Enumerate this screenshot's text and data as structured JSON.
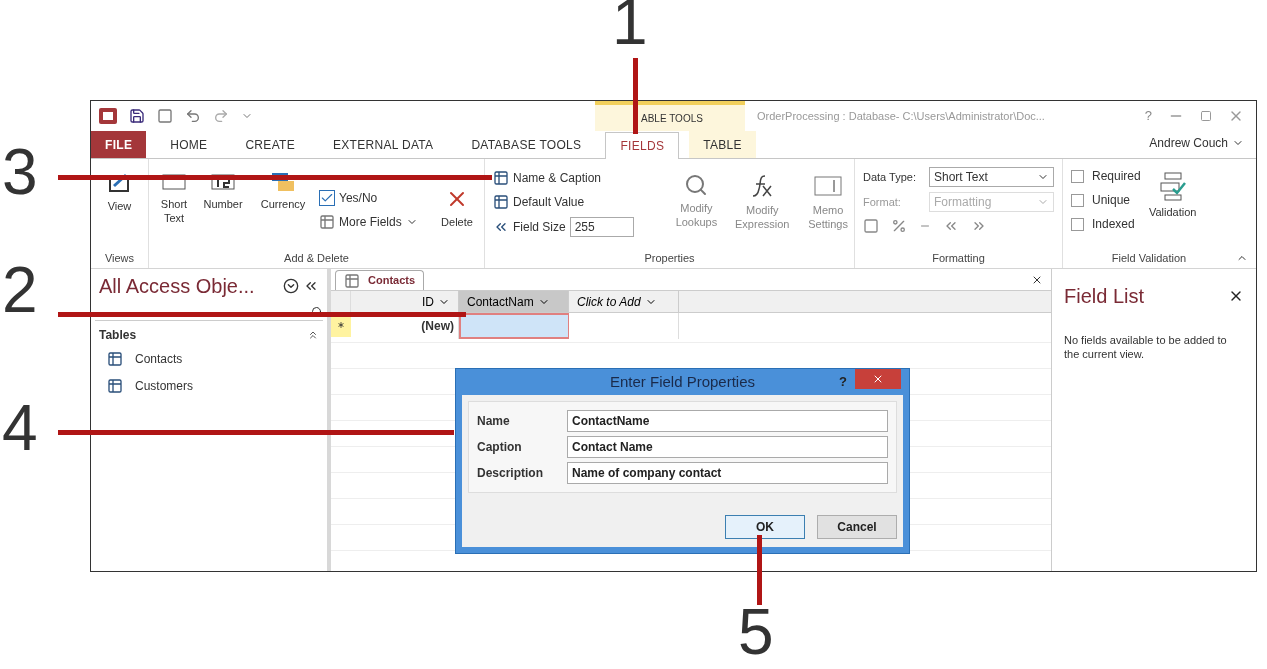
{
  "window": {
    "contextual_group": "ABLE TOOLS",
    "title": "OrderProcessing : Database- C:\\Users\\Administrator\\Doc...",
    "help": "?"
  },
  "tabs": [
    {
      "label": "FILE",
      "kind": "file",
      "selected": false
    },
    {
      "label": "HOME",
      "kind": "tab",
      "selected": false
    },
    {
      "label": "CREATE",
      "kind": "tab",
      "selected": false
    },
    {
      "label": "EXTERNAL DATA",
      "kind": "tab",
      "selected": false
    },
    {
      "label": "DATABASE TOOLS",
      "kind": "tab",
      "selected": false
    },
    {
      "label": "FIELDS",
      "kind": "context",
      "selected": true
    },
    {
      "label": "TABLE",
      "kind": "context",
      "selected": false
    }
  ],
  "user": "Andrew Couch",
  "ribbon": {
    "views": {
      "label": "Views",
      "button": "View"
    },
    "add_delete": {
      "label": "Add & Delete",
      "types": [
        "Short Text",
        "Number",
        "Currency"
      ],
      "yes_no": "Yes/No",
      "more_fields": "More Fields",
      "delete": "Delete"
    },
    "properties": {
      "label": "Properties",
      "name_caption": "Name & Caption",
      "default_value": "Default Value",
      "field_size_label": "Field Size",
      "field_size": "255",
      "buttons": [
        "Modify Lookups",
        "Modify Expression",
        "Memo Settings"
      ]
    },
    "formatting": {
      "label": "Formatting",
      "data_type_label": "Data Type:",
      "data_type": "Short Text",
      "format_label": "Format:",
      "format": "Formatting",
      "format_disabled": true
    },
    "field_validation": {
      "label": "Field Validation",
      "checks": [
        {
          "label": "Required",
          "checked": false
        },
        {
          "label": "Unique",
          "checked": false
        },
        {
          "label": "Indexed",
          "checked": false
        }
      ],
      "validation": "Validation"
    }
  },
  "navigation": {
    "title": "All Access Obje...",
    "section": "Tables",
    "items": [
      {
        "label": "Contacts"
      },
      {
        "label": "Customers"
      }
    ]
  },
  "datasheet": {
    "tab": "Contacts",
    "columns": [
      {
        "label": "ID",
        "kind": "field",
        "selected": false
      },
      {
        "label": "ContactNam",
        "kind": "field",
        "selected": true
      },
      {
        "label": "Click to Add",
        "kind": "add",
        "selected": false
      }
    ],
    "new_row": "(New)"
  },
  "dialog": {
    "title": "Enter Field Properties",
    "help": "?",
    "fields": [
      {
        "label": "Name",
        "value": "ContactName"
      },
      {
        "label": "Caption",
        "value": "Contact Name"
      },
      {
        "label": "Description",
        "value": "Name of company contact"
      }
    ],
    "buttons": [
      {
        "label": "OK",
        "default": true
      },
      {
        "label": "Cancel",
        "default": false
      }
    ]
  },
  "field_list": {
    "title": "Field List",
    "message": "No fields available to be added to the current view."
  },
  "callouts": [
    {
      "label": "1"
    },
    {
      "label": "3"
    },
    {
      "label": "2"
    },
    {
      "label": "4"
    },
    {
      "label": "5"
    }
  ]
}
